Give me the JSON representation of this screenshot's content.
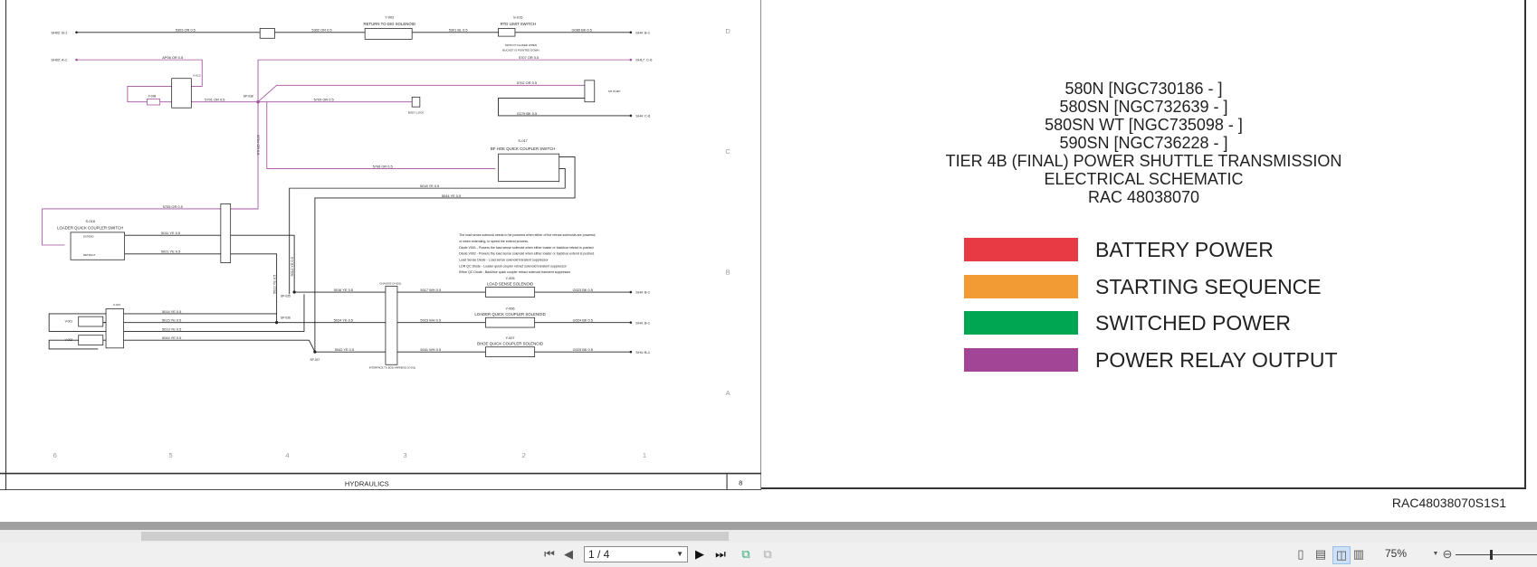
{
  "schematic": {
    "grid_rows": [
      "D",
      "C",
      "B",
      "A"
    ],
    "grid_cols": [
      "6",
      "5",
      "4",
      "3",
      "2",
      "1"
    ],
    "title_block": {
      "section": "HYDRAULICS",
      "page": "8"
    },
    "refs": {
      "sh02_b1": "SH02: B-1",
      "sh02_a1": "SH02: A-1",
      "sh4_b1_top": "SH4: B-1",
      "sh17_c6": "SH17: C-6",
      "sh4_c6": "SH4: C-6",
      "sh4_b1_a": "SH4: B-1",
      "sh4_b1_b": "SH4: B-1",
      "sh4_b1_c": "SH4: B-1"
    },
    "wires": {
      "w5303": "5303 OR 0.5",
      "w5302": "5302 OR 0.5",
      "w5301": "5301 BL 0.5",
      "g089": "G089 BK 0.5",
      "ap06": "AP06 OR 0.5",
      "w5701": "5701 OR 0.5",
      "w5707": "5707 OR 0.5",
      "w5702": "5702 OR 0.5",
      "w5709": "5709 OR 0.5",
      "g179": "G179 BK 0.5",
      "w5704": "5704 OR 0.5",
      "w5706": "5706 OR 0.5",
      "w5018": "5018 YE 0.5",
      "w5044a": "5044 YE 0.5",
      "w5705": "5705 OR 0.5",
      "w5011": "5011 YE 0.5",
      "w5021": "5021 YE 0.5",
      "w5022": "5022 YE 0.5",
      "w5012": "5012 YE 0.5",
      "w5016": "5016 YE 0.5",
      "w5017": "5017 WH 0.5",
      "g023": "G023 BK 0.5",
      "w5024": "5024 YE 0.5",
      "w5023": "5023 WH 0.5",
      "g024": "G024 BK 0.5",
      "w5042": "5042 YE 0.5",
      "w5041": "5041 WH 0.5",
      "g025": "G025 BK 0.5",
      "w5014": "5014 YE 0.5",
      "w5015": "5015 YE 0.5",
      "w5013": "5013 YE 0.5",
      "w5044b": "5044 YE 0.5"
    },
    "components": {
      "y002_id": "Y-002",
      "y002_name": "RETURN TO DIG SOLENOID",
      "s015_id": "S-015",
      "s015_name": "RTD LIMIT SWITCH",
      "s015_note1": "SWITCH CLOSED WHEN",
      "s015_note2": "BUCKET IS POINTED DOWN",
      "f038": "F-038",
      "k013": "K-013",
      "sp038": "SP-038",
      "body_lock": "BODY LOCK",
      "sh_clmp": "SH CLMP",
      "s017_id": "S-017",
      "s017_name": "BF HOE QUICK COUPLER SWITCH",
      "s018_id": "S-018",
      "s018_name": "LOADER QUICK COUPLER SWITCH",
      "extend": "EXTEND",
      "retract": "RETRACT",
      "sp035": "SP-035",
      "sp036": "SP-036",
      "sp037": "SP-037",
      "chassis": "CHASSIS (X-001)",
      "interface": "INTERFACE TO BOD HARNESS (X-001)",
      "y005_id": "Y-005",
      "y005_name": "LOAD SENSE SOLENOID",
      "y006_id": "Y-006",
      "y006_name": "LOADER QUICK COUPLER SOLENOID",
      "y007_id": "Y-007",
      "y007_name": "BHOE QUICK COUPLER SOLENOID",
      "v001": "V-001",
      "v002": "V-002",
      "x013": "X-013"
    },
    "notes": [
      "The load sense solenoid needs to be powered when either of the retract solenoids are powered,",
      "or when extending, to speed the extend process.",
      "Diode V001 - Powers the load sense solenoid when either loader or backhoe retract is pushed.",
      "Diode V002 - Powers the load sense solenoid when either loader or backhoe extend is pushed.",
      "Load Sense Diode - Load sense solenoid transient suppressor",
      "LDR QC Diode - Loader quick coupler retract solenoid transient suppressor",
      "BHoe QC Diode - Backhoe quick coupler retract solenoid transient suppressor"
    ],
    "colors": {
      "wire": "#222222",
      "relay_wire": "#a0509f"
    }
  },
  "cover": {
    "lines": [
      "580N [NGC730186 - ]",
      "580SN [NGC732639 - ]",
      "580SN WT [NGC735098 - ]",
      "590SN [NGC736228 - ]",
      "TIER 4B (FINAL) POWER SHUTTLE TRANSMISSION",
      "ELECTRICAL SCHEMATIC",
      "RAC 48038070"
    ],
    "legend": [
      {
        "label": "BATTERY POWER",
        "color": "#e83a44"
      },
      {
        "label": "STARTING SEQUENCE",
        "color": "#f29a34"
      },
      {
        "label": "SWITCHED POWER",
        "color": "#00a651"
      },
      {
        "label": "POWER RELAY OUTPUT",
        "color": "#a24597"
      }
    ]
  },
  "document_id": "RAC48038070S1S1",
  "toolbar": {
    "page_value": "1 / 4",
    "zoom": "75%",
    "icons": [
      "first-page-icon",
      "prev-page-icon",
      "next-page-icon",
      "last-page-icon",
      "rotate-icon",
      "thumbnail-icon",
      "single-page-icon",
      "continuous-icon",
      "two-page-icon",
      "facing-icon",
      "zoom-out-icon"
    ]
  }
}
